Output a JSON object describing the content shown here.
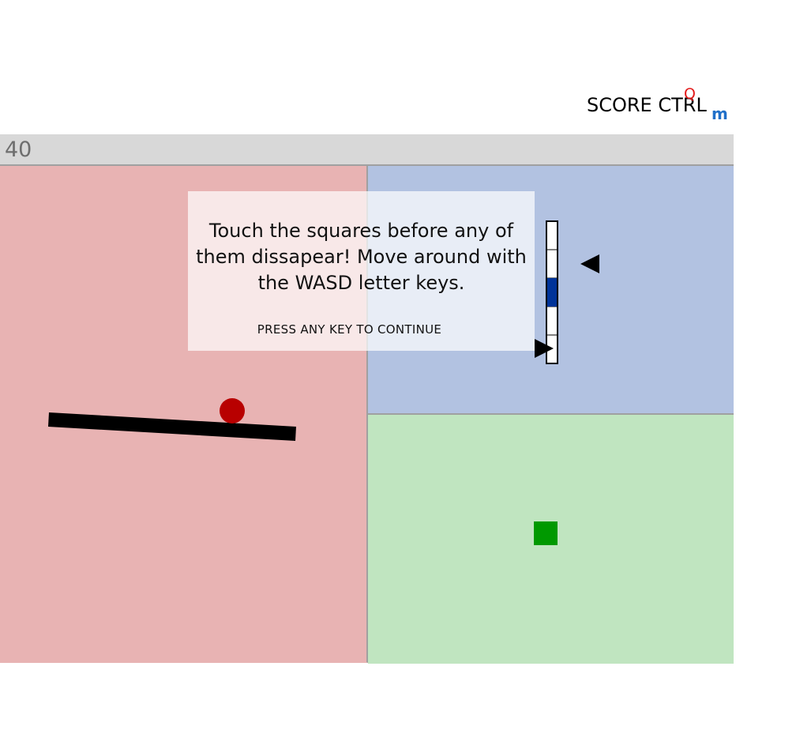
{
  "header": {
    "score_ctrl_label": "SCORE CTRL",
    "ctrl_q_label": "Q",
    "ctrl_m_label": "m"
  },
  "timer": {
    "value": "40"
  },
  "panels": {
    "red_color": "#e8b3b3",
    "blue_color": "#b2c2e1",
    "green_color": "#c0e5c0"
  },
  "balance_game": {
    "ball_color": "#b80000",
    "beam_color": "#000000"
  },
  "gauge_game": {
    "segments": 5,
    "active_segment": 3,
    "active_color": "#003399",
    "pointer_icons": [
      "triangle-left-icon",
      "triangle-right-icon"
    ]
  },
  "square_game": {
    "square_color": "#009900"
  },
  "overlay": {
    "message": "Touch the squares before any of them dissapear! Move around with the WASD letter keys.",
    "continue_text": "PRESS ANY KEY TO CONTINUE"
  }
}
